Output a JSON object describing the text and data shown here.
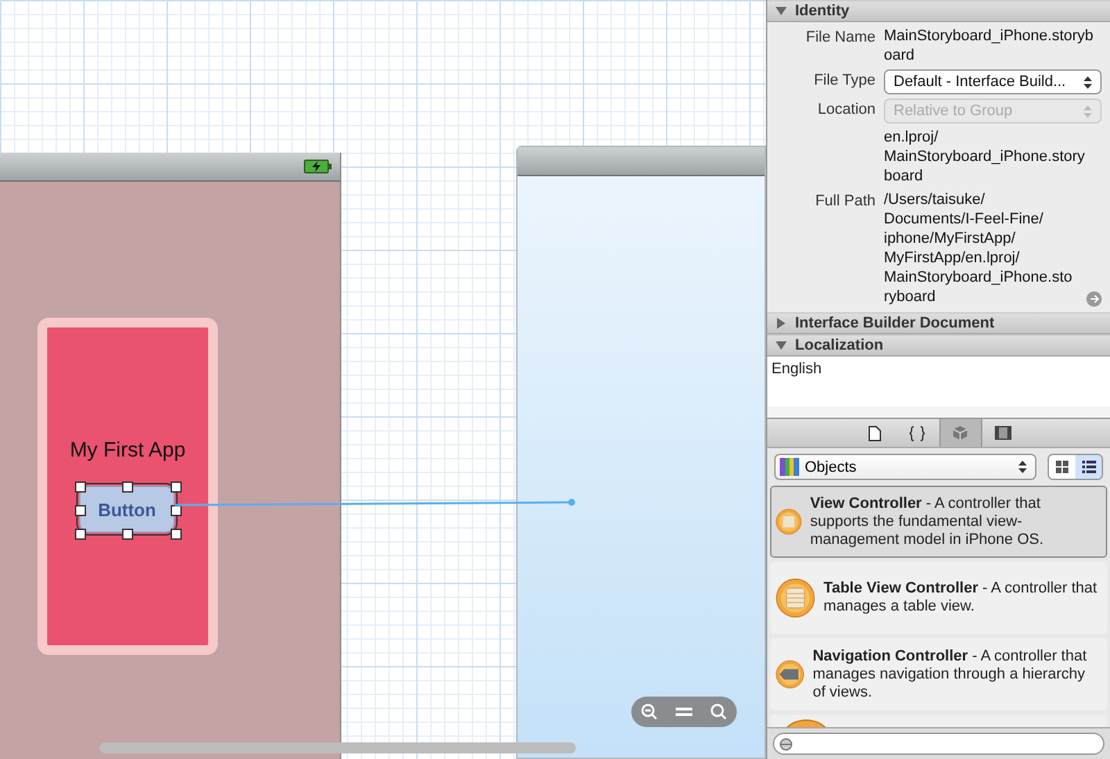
{
  "storyboard": {
    "title_label": "My First App",
    "button": {
      "text": "Button",
      "selected": true
    }
  },
  "inspector": {
    "sections": [
      {
        "title": "Identity",
        "expanded": true,
        "fields": [
          {
            "label": "File Name",
            "kind": "text",
            "lines": [
              "MainStoryboard_iPhone.storyb",
              "oard"
            ]
          },
          {
            "label": "File Type",
            "kind": "select",
            "value": "Default - Interface Build...",
            "disabled": false
          },
          {
            "label": "Location",
            "kind": "select",
            "value": "Relative to Group",
            "disabled": true
          },
          {
            "kind": "text",
            "lines": [
              "en.lproj/",
              "MainStoryboard_iPhone.story",
              "board"
            ]
          },
          {
            "label": "Full Path",
            "kind": "path",
            "lines": [
              "/Users/taisuke/",
              "Documents/I-Feel-Fine/",
              "iphone/MyFirstApp/",
              "MyFirstApp/en.lproj/",
              "MainStoryboard_iPhone.sto",
              "ryboard"
            ]
          }
        ]
      },
      {
        "title": "Interface Builder Document",
        "expanded": false
      },
      {
        "title": "Localization",
        "expanded": true,
        "list": [
          "English"
        ]
      }
    ]
  },
  "library": {
    "tabs": [
      {
        "kind": "file",
        "selected": false
      },
      {
        "kind": "code",
        "selected": false
      },
      {
        "kind": "object",
        "selected": true
      },
      {
        "kind": "media",
        "selected": false
      }
    ],
    "filter": "Objects",
    "view_modes": [
      {
        "kind": "grid",
        "selected": false
      },
      {
        "kind": "list",
        "selected": true
      }
    ],
    "items": [
      {
        "kind": "view",
        "text": "**View Controller** - A controller that supports the fundamental view-management model in iPhone OS.",
        "selected": true
      },
      {
        "kind": "table",
        "text": "**Table View Controller** - A controller that manages a table view.",
        "selected": false
      },
      {
        "kind": "navigation",
        "text": "**Navigation Controller** - A controller that manages navigation through a hierarchy of views.",
        "selected": false
      },
      {
        "kind": "partial",
        "selected": false
      }
    ]
  }
}
